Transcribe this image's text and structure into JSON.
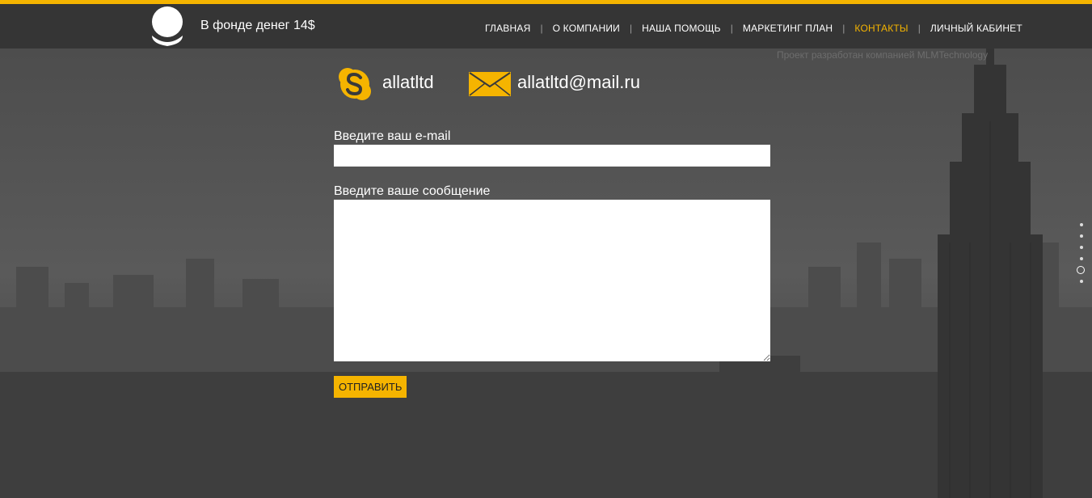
{
  "header": {
    "fund_text": "В фонде денег 14$",
    "nav": [
      {
        "label": "ГЛАВНАЯ",
        "active": false
      },
      {
        "label": "О КОМПАНИИ",
        "active": false
      },
      {
        "label": "НАША ПОМОЩЬ",
        "active": false
      },
      {
        "label": "МАРКЕТИНГ ПЛАН",
        "active": false
      },
      {
        "label": "КОНТАКТЫ",
        "active": true
      },
      {
        "label": "ЛИЧНЫЙ КАБИНЕТ",
        "active": false
      }
    ],
    "separator": "|",
    "credit": "Проект разработан компанией MLMTechnology"
  },
  "contacts": {
    "skype": "allatltd",
    "email": "allatltd@mail.ru"
  },
  "form": {
    "email_label": "Введите ваш e-mail",
    "email_value": "",
    "message_label": "Введите ваше сообщение",
    "message_value": "",
    "submit_label": "ОТПРАВИТЬ"
  },
  "page_dots": {
    "count": 6,
    "active_index": 4
  },
  "colors": {
    "accent": "#f5b400",
    "header_bg": "#353535",
    "text": "#ffffff"
  },
  "icons": [
    "logo-icon",
    "skype-icon",
    "mail-icon"
  ]
}
